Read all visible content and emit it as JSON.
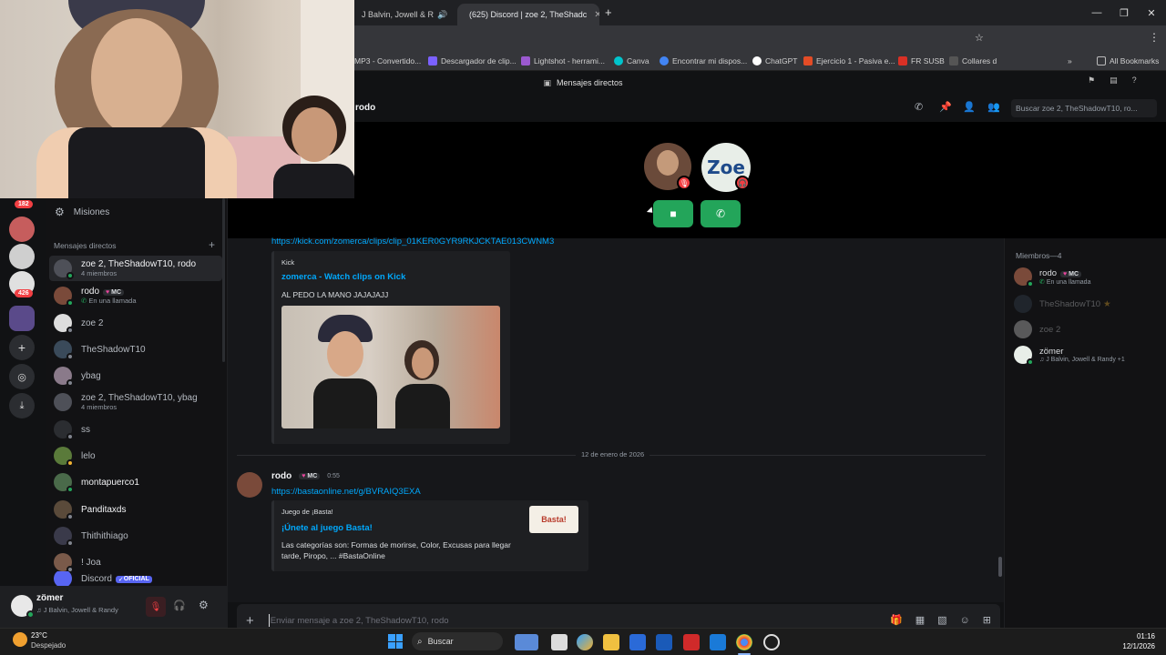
{
  "browser": {
    "tabs": [
      {
        "title": "J Balvin, Jowell & R",
        "active": false
      },
      {
        "title": "(625) Discord | zoe 2, TheShadc",
        "active": true
      }
    ],
    "bookmarks": [
      "MP3 - Convertido...",
      "Descargador de clip...",
      "Lightshot - herrami...",
      "Canva",
      "Encontrar mi dispos...",
      "ChatGPT",
      "Ejercicio 1 - Pasiva e...",
      "FR SUSB",
      "Collares d"
    ],
    "all_bookmarks": "All Bookmarks"
  },
  "discord": {
    "window_title": "Mensajes directos",
    "guild_badges": {
      "top": "182",
      "mid": "426"
    },
    "sidebar": {
      "quests": "Misiones",
      "dm_header": "Mensajes directos",
      "dms": [
        {
          "name": "zoe 2, TheShadowT10, rodo",
          "sub": "4 miembros",
          "active": true
        },
        {
          "name": "rodo",
          "tag": "MC",
          "sub": "En una llamada"
        },
        {
          "name": "zoe 2"
        },
        {
          "name": "TheShadowT10"
        },
        {
          "name": "ybag"
        },
        {
          "name": "zoe 2, TheShadowT10, ybag",
          "sub": "4 miembros"
        },
        {
          "name": "ss"
        },
        {
          "name": "lelo"
        },
        {
          "name": "montapuerco1",
          "bright": true
        },
        {
          "name": "Panditaxds",
          "bright": true
        },
        {
          "name": "Thithithiago"
        },
        {
          "name": "! Joa"
        },
        {
          "name": "Discord",
          "tag": "OFICIAL"
        }
      ]
    },
    "user_panel": {
      "name": "zömer",
      "activity": "J Balvin, Jowell & Randy"
    },
    "header": {
      "channel": "rodo",
      "search_placeholder": "Buscar zoe 2, TheShadowT10, ro..."
    },
    "chat": {
      "top_link": "https://kick.com/zomerca/clips/clip_01KER0GYR9RKJCKTAE013CWNM3",
      "kick_embed": {
        "provider": "Kick",
        "title": "zomerca - Watch clips on Kick",
        "description": "AL PEDO LA MANO JAJAJAJJ"
      },
      "date_divider": "12 de enero de 2026",
      "message": {
        "author": "rodo",
        "tag": "MC",
        "time": "0:55",
        "link": "https://bastaonline.net/g/BVRAIQ3EXA",
        "embed": {
          "provider": "Juego de ¡Basta!",
          "title": "¡Únete al juego Basta!",
          "description": "Las categorías son: Formas de morirse, Color, Excusas para llegar tarde, Piropo, ... #BastaOnline",
          "thumb_text": "Basta!"
        }
      },
      "composer_placeholder": "Enviar mensaje a zoe 2, TheShadowT10, rodo"
    },
    "members": {
      "header": "Miembros—4",
      "list": [
        {
          "name": "rodo",
          "tag": "MC",
          "sub": "En una llamada",
          "online": true
        },
        {
          "name": "TheShadowT10",
          "online": false
        },
        {
          "name": "zoe 2",
          "online": false
        },
        {
          "name": "zömer",
          "sub": "J Balvin, Jowell & Randy +1",
          "online": true
        }
      ]
    },
    "call": {
      "avatar2_label": "Zoe"
    }
  },
  "taskbar": {
    "weather_temp": "23°C",
    "weather_desc": "Despejado",
    "search": "Buscar",
    "time": "01:16",
    "date": "12/1/2026"
  }
}
